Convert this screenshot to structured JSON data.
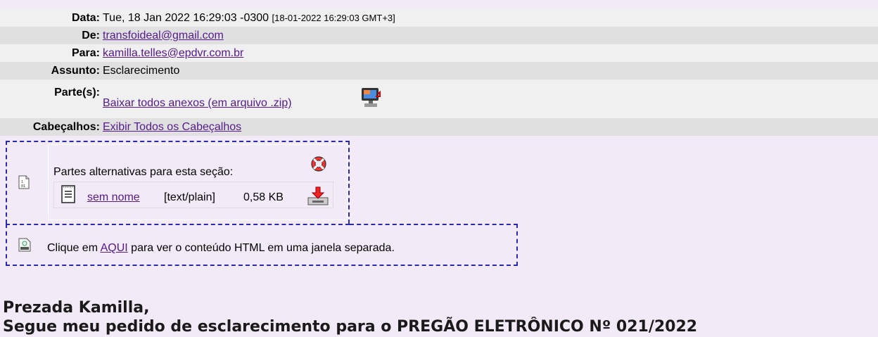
{
  "headers": {
    "data_label": "Data:",
    "data_value": "Tue, 18 Jan 2022 16:29:03 -0300",
    "data_local": "[18-01-2022 16:29:03 GMT+3]",
    "de_label": "De:",
    "de_value": "transfoideal@gmail.com",
    "para_label": "Para:",
    "para_value": "kamilla.telles@epdvr.com.br",
    "assunto_label": "Assunto:",
    "assunto_value": "Esclarecimento",
    "partes_label": "Parte(s):",
    "partes_link": "Baixar todos anexos (em arquivo .zip)",
    "cabecalhos_label": "Cabeçalhos:",
    "cabecalhos_link": "Exibir Todos os Cabeçalhos"
  },
  "alternatives": {
    "title": "Partes alternativas para esta seção:",
    "part_name": "sem nome",
    "part_type": "[text/plain]",
    "part_size": "0,58 KB"
  },
  "html_notice": {
    "prefix": "Clique em",
    "link": "AQUI",
    "suffix": "para ver o conteúdo HTML em uma janela separada."
  },
  "body": {
    "line1": "Prezada Kamilla,",
    "line2": "Segue meu pedido de esclarecimento para o PREGÃO ELETRÔNICO Nº 021/2022"
  }
}
